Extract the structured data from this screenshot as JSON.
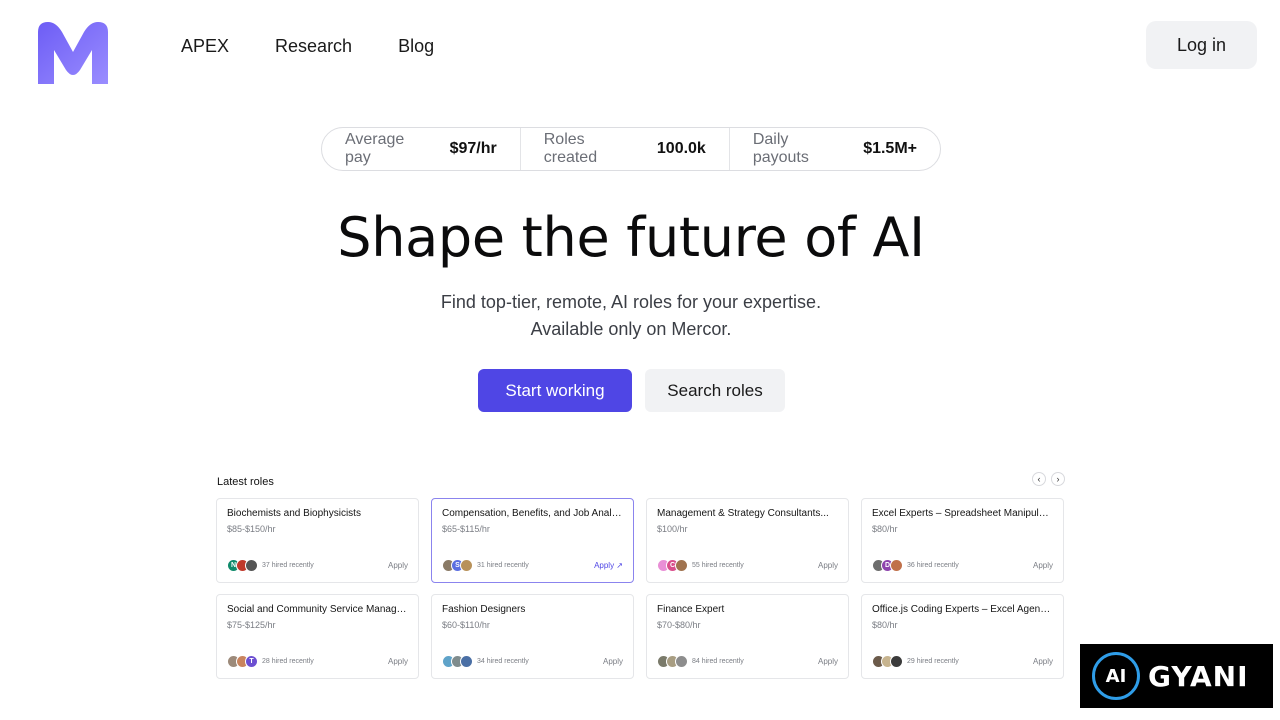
{
  "header": {
    "logo": "M",
    "nav": [
      "APEX",
      "Research",
      "Blog"
    ],
    "login_label": "Log in"
  },
  "stats": [
    {
      "label": "Average pay",
      "value": "$97/hr"
    },
    {
      "label": "Roles created",
      "value": "100.0k"
    },
    {
      "label": "Daily payouts",
      "value": "$1.5M+"
    }
  ],
  "hero": {
    "title": "Shape the future of AI",
    "subtitle_line1": "Find top-tier, remote, AI roles for your expertise.",
    "subtitle_line2": "Available only on Mercor.",
    "primary_cta": "Start working",
    "secondary_cta": "Search roles"
  },
  "roles": {
    "heading": "Latest roles",
    "prev_icon": "‹",
    "next_icon": "›",
    "apply_label": "Apply",
    "cards": [
      {
        "title": "Biochemists and Biophysicists",
        "pay": "$85-$150/hr",
        "hired": "37 hired recently",
        "apply": "Apply",
        "avatars": [
          {
            "initial": "N",
            "color": "#0f8a6a"
          },
          {
            "initial": "",
            "color": "#c0392b"
          },
          {
            "initial": "",
            "color": "#555555"
          }
        ]
      },
      {
        "title": "Compensation, Benefits, and Job Analysis...",
        "pay": "$65-$115/hr",
        "hired": "31 hired recently",
        "apply": "Apply ↗",
        "avatars": [
          {
            "initial": "",
            "color": "#8a7a66"
          },
          {
            "initial": "S",
            "color": "#5b6ee1"
          },
          {
            "initial": "",
            "color": "#b8915a"
          }
        ]
      },
      {
        "title": "Management & Strategy Consultants...",
        "pay": "$100/hr",
        "hired": "55 hired recently",
        "apply": "Apply",
        "avatars": [
          {
            "initial": "",
            "color": "#e98fd6"
          },
          {
            "initial": "C",
            "color": "#d94f8c"
          },
          {
            "initial": "",
            "color": "#a0734f"
          }
        ]
      },
      {
        "title": "Excel Experts – Spreadsheet Manipulatio...",
        "pay": "$80/hr",
        "hired": "36 hired recently",
        "apply": "Apply",
        "avatars": [
          {
            "initial": "",
            "color": "#6d6d6d"
          },
          {
            "initial": "D",
            "color": "#8e44ad"
          },
          {
            "initial": "",
            "color": "#c0704a"
          }
        ]
      },
      {
        "title": "Social and Community Service Managers",
        "pay": "$75-$125/hr",
        "hired": "28 hired recently",
        "apply": "Apply",
        "avatars": [
          {
            "initial": "",
            "color": "#9c8a7a"
          },
          {
            "initial": "",
            "color": "#c9845e"
          },
          {
            "initial": "T",
            "color": "#6c4fd1"
          }
        ]
      },
      {
        "title": "Fashion Designers",
        "pay": "$60-$110/hr",
        "hired": "34 hired recently",
        "apply": "Apply",
        "avatars": [
          {
            "initial": "",
            "color": "#5fa3c9"
          },
          {
            "initial": "",
            "color": "#7f8c8d"
          },
          {
            "initial": "",
            "color": "#4a6fa5"
          }
        ]
      },
      {
        "title": "Finance Expert",
        "pay": "$70-$80/hr",
        "hired": "84 hired recently",
        "apply": "Apply",
        "avatars": [
          {
            "initial": "",
            "color": "#7a7a6a"
          },
          {
            "initial": "",
            "color": "#a89d82"
          },
          {
            "initial": "",
            "color": "#8d8d8d"
          }
        ]
      },
      {
        "title": "Office.js Coding Experts – Excel Agent AI...",
        "pay": "$80/hr",
        "hired": "29 hired recently",
        "apply": "Apply",
        "avatars": [
          {
            "initial": "",
            "color": "#6b5a4a"
          },
          {
            "initial": "",
            "color": "#c7b48f"
          },
          {
            "initial": "",
            "color": "#3b3b3b"
          }
        ]
      }
    ]
  },
  "watermark": {
    "badge": "AI",
    "text": "GYANI"
  },
  "colors": {
    "accent": "#4f46e5",
    "logo_gradient": [
      "#6d5df5",
      "#8b7cff"
    ]
  }
}
